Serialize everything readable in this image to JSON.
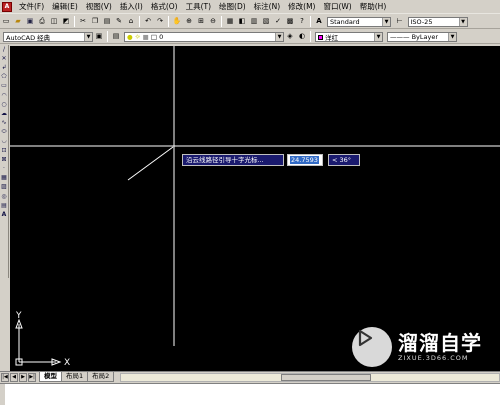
{
  "menu": {
    "items": [
      "文件(F)",
      "编辑(E)",
      "视图(V)",
      "插入(I)",
      "格式(O)",
      "工具(T)",
      "绘图(D)",
      "标注(N)",
      "修改(M)",
      "窗口(W)",
      "帮助(H)"
    ]
  },
  "toolbar1": {
    "text_style": "Standard",
    "dim_style": "ISO-25"
  },
  "toolbar2": {
    "workspace": "AutoCAD 经典",
    "layer_value": "0",
    "color_value": "洋红",
    "linetype_value": "ByLayer"
  },
  "canvas": {
    "prompt_text": "沿云线路径引导十字光标...",
    "length_value": "24.7593",
    "angle_value": "< 36°",
    "ucs_x_label": "X",
    "ucs_y_label": "Y"
  },
  "tabs": {
    "model": "模型",
    "layout1": "布局1",
    "layout2": "布局2"
  },
  "watermark": {
    "title": "溜溜自学",
    "url": "ZIXUE.3D66.COM"
  },
  "colors": {
    "canvas_bg": "#000000",
    "chrome_bg": "#d4d0c8",
    "tooltip_bg": "#1a1a6e",
    "selection": "#316ac5"
  }
}
